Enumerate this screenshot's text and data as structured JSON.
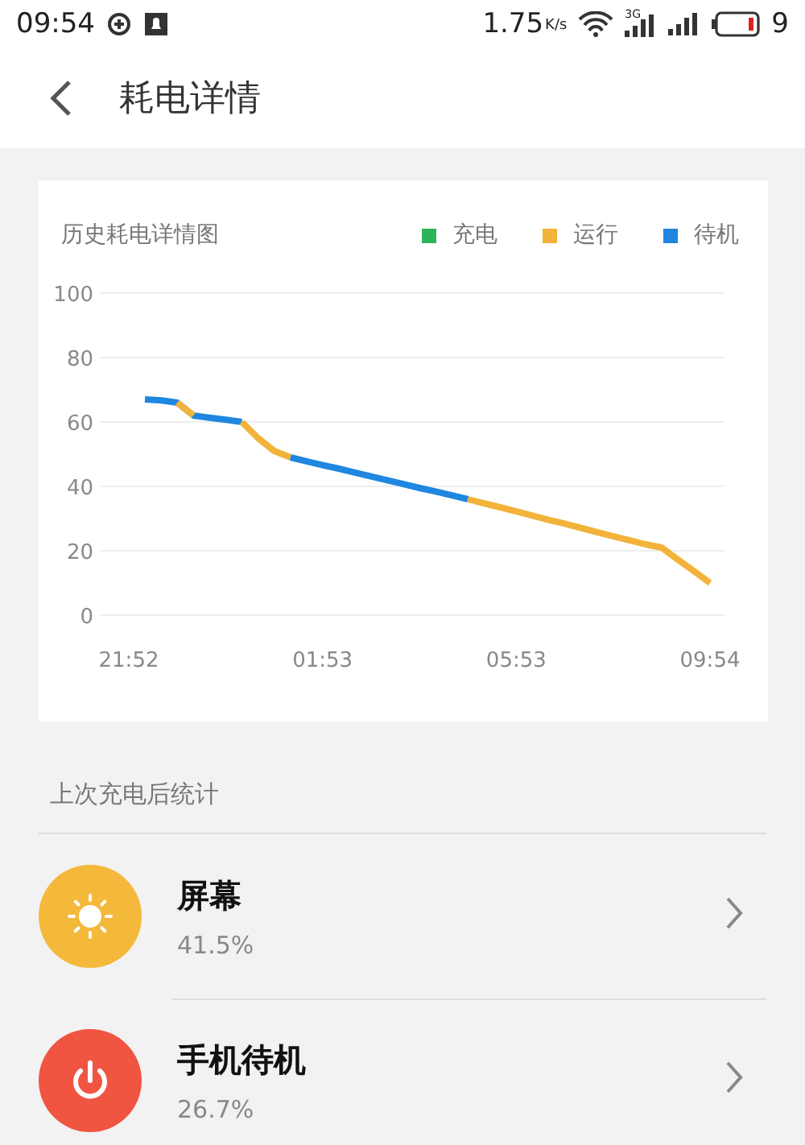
{
  "status_bar": {
    "time": "09:54",
    "speed": "1.75",
    "speed_unit": "K/s",
    "network": "3G",
    "battery": "9"
  },
  "header": {
    "title": "耗电详情"
  },
  "chart_card": {
    "title": "历史耗电详情图",
    "chart_data": {
      "type": "line",
      "categories": [
        "21:52",
        null,
        null,
        null,
        null,
        null,
        null,
        null,
        null,
        null,
        null,
        null,
        "01:53",
        null,
        null,
        null,
        null,
        null,
        null,
        null,
        null,
        null,
        null,
        null,
        "05:53",
        null,
        null,
        null,
        null,
        null,
        null,
        null,
        null,
        null,
        null,
        null,
        "09:54"
      ],
      "series": [
        {
          "name": "充电",
          "color": "#2fb35a",
          "values": [
            null,
            null,
            null,
            null,
            null,
            null,
            null,
            null,
            null,
            null,
            null,
            null,
            null,
            null,
            null,
            null,
            null,
            null,
            null,
            null,
            null,
            null,
            null,
            null,
            null,
            null,
            null,
            null,
            null,
            null,
            null,
            null,
            null,
            null,
            null,
            null,
            null
          ]
        },
        {
          "name": "运行",
          "color": "#f3b33a",
          "values": [
            null,
            null,
            null,
            66,
            62,
            null,
            null,
            60,
            55,
            51,
            49,
            null,
            null,
            null,
            null,
            null,
            null,
            null,
            null,
            null,
            null,
            36,
            34.7,
            33.5,
            32.2,
            30.9,
            29.6,
            28.4,
            27.1,
            25.8,
            24.5,
            23.3,
            22,
            21,
            17.3,
            13.7,
            10
          ]
        },
        {
          "name": "待机",
          "color": "#1f87e0",
          "values": [
            null,
            67,
            66.7,
            66,
            62,
            61.3,
            60.7,
            60,
            null,
            null,
            49,
            47.8,
            46.6,
            45.5,
            44.3,
            43.1,
            41.9,
            40.7,
            39.5,
            38.4,
            37.2,
            36,
            null,
            null,
            null,
            null,
            null,
            null,
            null,
            null,
            null,
            null,
            null,
            null,
            null,
            null,
            null
          ]
        }
      ],
      "ylim": [
        0,
        100
      ],
      "grid": true,
      "yticks": [
        0,
        20,
        40,
        60,
        80,
        100
      ]
    }
  },
  "stats": {
    "title": "上次充电后统计",
    "items": [
      {
        "kind": "screen",
        "name": "屏幕",
        "percent": "41.5%",
        "color": "#f4b83a"
      },
      {
        "kind": "standby",
        "name": "手机待机",
        "percent": "26.7%",
        "color": "#f05542"
      }
    ]
  }
}
